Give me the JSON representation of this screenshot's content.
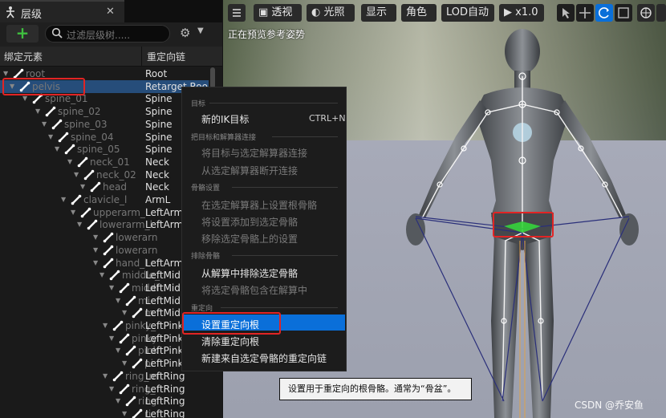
{
  "panel": {
    "tab_title": "层级",
    "tab_close": "✕",
    "add_button": "+",
    "search_placeholder": "过滤层级树.....",
    "col_bone": "绑定元素",
    "col_chain": "重定向链"
  },
  "tree_rows": [
    {
      "name": "root",
      "chain": "Root"
    },
    {
      "name": "pelvis",
      "chain": "Retarget Roo"
    },
    {
      "name": "spine_01",
      "chain": "Spine"
    },
    {
      "name": "spine_02",
      "chain": "Spine"
    },
    {
      "name": "spine_03",
      "chain": "Spine"
    },
    {
      "name": "spine_04",
      "chain": "Spine"
    },
    {
      "name": "spine_05",
      "chain": "Spine"
    },
    {
      "name": "neck_01",
      "chain": "Neck"
    },
    {
      "name": "neck_02",
      "chain": "Neck"
    },
    {
      "name": "head",
      "chain": "Neck"
    },
    {
      "name": "clavicle_l",
      "chain": "ArmL"
    },
    {
      "name": "upperarm_l",
      "chain": "LeftArm"
    },
    {
      "name": "lowerarm_l",
      "chain": "LeftArm"
    },
    {
      "name": "lowerarn",
      "chain": ""
    },
    {
      "name": "lowerarn",
      "chain": ""
    },
    {
      "name": "hand_l",
      "chain": "LeftArm"
    },
    {
      "name": "middle_",
      "chain": "LeftMid"
    },
    {
      "name": "middl",
      "chain": "LeftMid"
    },
    {
      "name": "mi",
      "chain": "LeftMid"
    },
    {
      "name": "m",
      "chain": "LeftMid"
    },
    {
      "name": "pinky_",
      "chain": "LeftPink"
    },
    {
      "name": "pinky",
      "chain": "LeftPink"
    },
    {
      "name": "pink",
      "chain": "LeftPink"
    },
    {
      "name": "pi",
      "chain": "LeftPink"
    },
    {
      "name": "ring_m",
      "chain": "LeftRing"
    },
    {
      "name": "ring_",
      "chain": "LeftRing"
    },
    {
      "name": "ring",
      "chain": "LeftRing"
    },
    {
      "name": "ri",
      "chain": "LeftRing"
    }
  ],
  "viewport": {
    "perspective": "透视",
    "lighting": "光照",
    "show": "显示",
    "character": "角色",
    "lod": "LOD自动",
    "speed": "x1.0",
    "status": "正在预览参考姿势"
  },
  "menu": {
    "sec_target": "目标",
    "new_ik": "新的IK目标",
    "new_ik_shortcut": "CTRL+N",
    "sec_connect": "把目标和解算器连接",
    "connect": "将目标与选定解算器连接",
    "disconnect": "从选定解算器断开连接",
    "sec_bone_settings": "骨骼设置",
    "add_root": "在选定解算器上设置根骨骼",
    "add_settings": "将设置添加到选定骨骼",
    "remove_settings": "移除选定骨骼上的设置",
    "sec_exclude": "排除骨骼",
    "exclude": "从解算中排除选定骨骼",
    "include": "将选定骨骼包含在解算中",
    "sec_retarget": "重定向",
    "set_root": "设置重定向根",
    "clear_root": "清除重定向根",
    "new_chain": "新建来自选定骨骼的重定向链"
  },
  "tooltip": "设置用于重定向的根骨骼。通常为“骨盆”。",
  "watermark": "CSDN @乔安鱼",
  "colors": {
    "accent": "#0a6fd9",
    "highlight": "#e12424",
    "add": "#3fbf3f"
  }
}
